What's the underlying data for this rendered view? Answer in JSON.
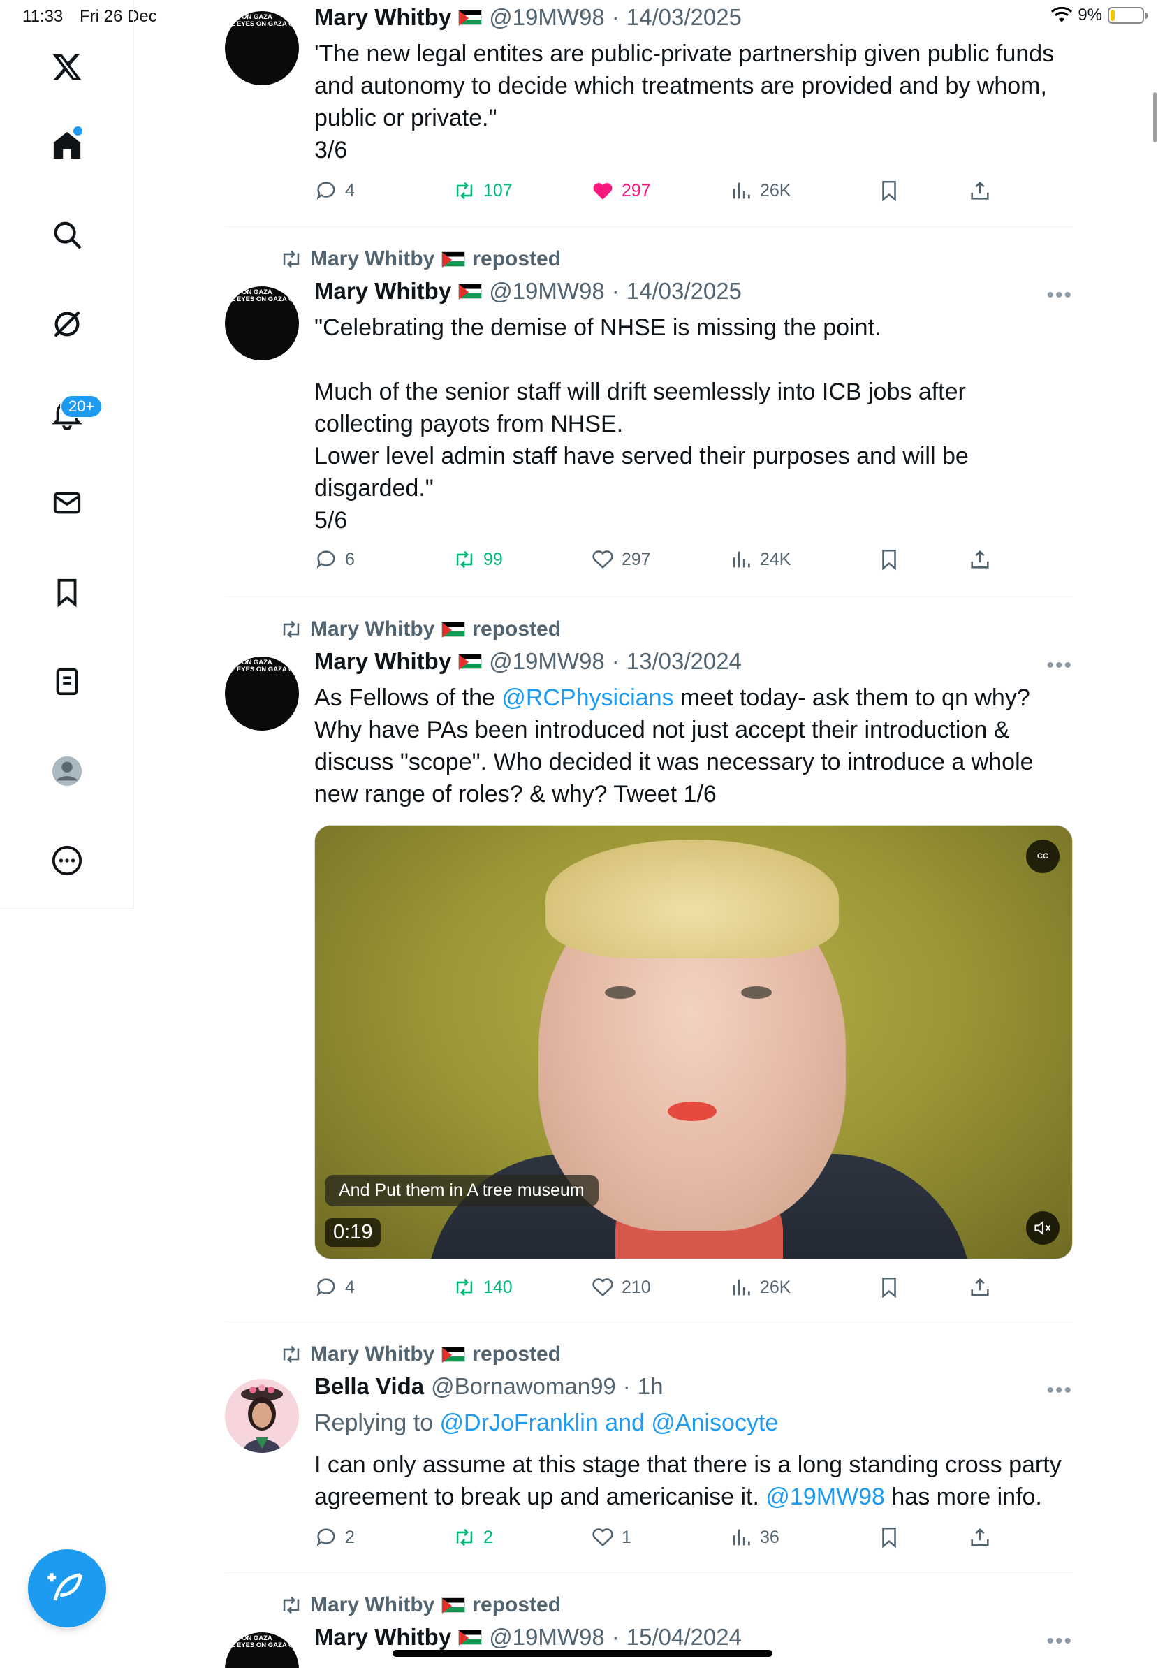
{
  "status_bar": {
    "time": "11:33",
    "date": "Fri 26 Dec",
    "battery": "9%",
    "dots": "•••"
  },
  "nav": {
    "notifications_badge": "20+"
  },
  "tweets": [
    {
      "name": "Mary Whitby",
      "handle": "@19MW98",
      "sep": "·",
      "date": "14/03/2025",
      "body": "'The new legal entites are public-private partnership given public funds\nand autonomy to decide which treatments are provided and by whom,\npublic or private.\"\n3/6",
      "replies": "4",
      "reposts": "107",
      "likes": "297",
      "views": "26K",
      "liked": true
    },
    {
      "repost_by": "Mary Whitby",
      "repost_label": "reposted",
      "name": "Mary Whitby",
      "handle": "@19MW98",
      "sep": "·",
      "date": "14/03/2025",
      "body": "\"Celebrating the demise of NHSE is missing the point.\n\nMuch of the senior staff will drift seemlessly into ICB jobs after\ncollecting payots from NHSE.\nLower level admin staff have served their purposes and will be\ndisgarded.\"\n5/6",
      "replies": "6",
      "reposts": "99",
      "likes": "297",
      "views": "24K"
    },
    {
      "repost_by": "Mary Whitby",
      "repost_label": "reposted",
      "name": "Mary Whitby",
      "handle": "@19MW98",
      "sep": "·",
      "date": "13/03/2024",
      "body_pre": "As Fellows of the ",
      "body_link": "@RCPhysicians",
      "body_post": " meet today- ask them to qn why?\nWhy have PAs been introduced not just accept their introduction &\ndiscuss \"scope\". Who decided it was necessary to introduce a whole\nnew range of roles? & why? Tweet 1/6",
      "video": {
        "caption": "And Put them in A tree museum",
        "duration": "0:19",
        "cc": "CC"
      },
      "replies": "4",
      "reposts": "140",
      "likes": "210",
      "views": "26K"
    },
    {
      "repost_by": "Mary Whitby",
      "repost_label": "reposted",
      "name": "Bella Vida",
      "handle": "@Bornawoman99",
      "sep": "·",
      "date": "1h",
      "replying_label": "Replying to ",
      "replying_to": "@DrJoFranklin and @Anisocyte",
      "body_pre": "I can only assume at this stage that there is a long standing cross party\nagreement to break up and americanise it. ",
      "body_link": "@19MW98",
      "body_post": " has more info.",
      "replies": "2",
      "reposts": "2",
      "likes": "1",
      "views": "36"
    },
    {
      "repost_by": "Mary Whitby",
      "repost_label": "reposted",
      "name": "Mary Whitby",
      "handle": "@19MW98",
      "sep": "·",
      "date": "15/04/2024"
    }
  ],
  "colors": {
    "accent": "#1d9bf0",
    "repost": "#00ba7c",
    "like": "#f91880",
    "muted": "#536471"
  },
  "avatar_text": "EYES ON GAZA\nALL EYES ON GAZA CITY"
}
